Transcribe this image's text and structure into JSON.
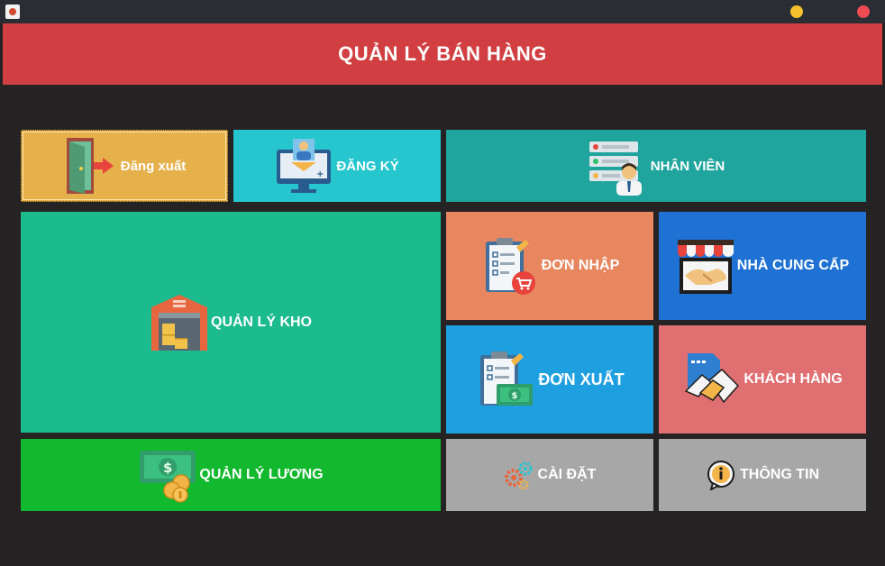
{
  "window": {
    "icon": "java-cup-icon",
    "controls": [
      {
        "name": "minimize-button",
        "color": "#f4c12e"
      },
      {
        "name": "close-button",
        "color": "#ee4c54"
      }
    ]
  },
  "header": {
    "title": "QUẢN LÝ BÁN HÀNG",
    "color": "#d13f42"
  },
  "tiles": {
    "logout": {
      "label": "Đăng xuất",
      "icon": "exit-door-icon",
      "color": "#e6b04a"
    },
    "register": {
      "label": "ĐĂNG KÝ",
      "icon": "computer-user-icon",
      "color": "#26c6cf"
    },
    "employee": {
      "label": "NHÂN VIÊN",
      "icon": "employee-list-icon",
      "color": "#1fa59d"
    },
    "warehouse": {
      "label": "QUẢN LÝ KHO",
      "icon": "warehouse-icon",
      "color": "#1bbb8e"
    },
    "import": {
      "label": "ĐƠN NHẬP",
      "icon": "clipboard-cart-icon",
      "color": "#e8865f"
    },
    "supplier": {
      "label": "NHÀ CUNG CẤP",
      "icon": "store-handshake-icon",
      "color": "#1f72d4"
    },
    "export": {
      "label": "ĐƠN XUẤT",
      "icon": "clipboard-money-icon",
      "color": "#1e9fe0"
    },
    "customer": {
      "label": "KHÁCH HÀNG",
      "icon": "contract-handshake-icon",
      "color": "#e06f72"
    },
    "salary": {
      "label": "QUẢN LÝ LƯƠNG",
      "icon": "money-coins-icon",
      "color": "#12b82e"
    },
    "settings": {
      "label": "CÀI ĐẶT",
      "icon": "gears-icon",
      "color": "#a7a7a7"
    },
    "info": {
      "label": "THÔNG TIN",
      "icon": "info-icon",
      "color": "#a7a7a7"
    }
  }
}
